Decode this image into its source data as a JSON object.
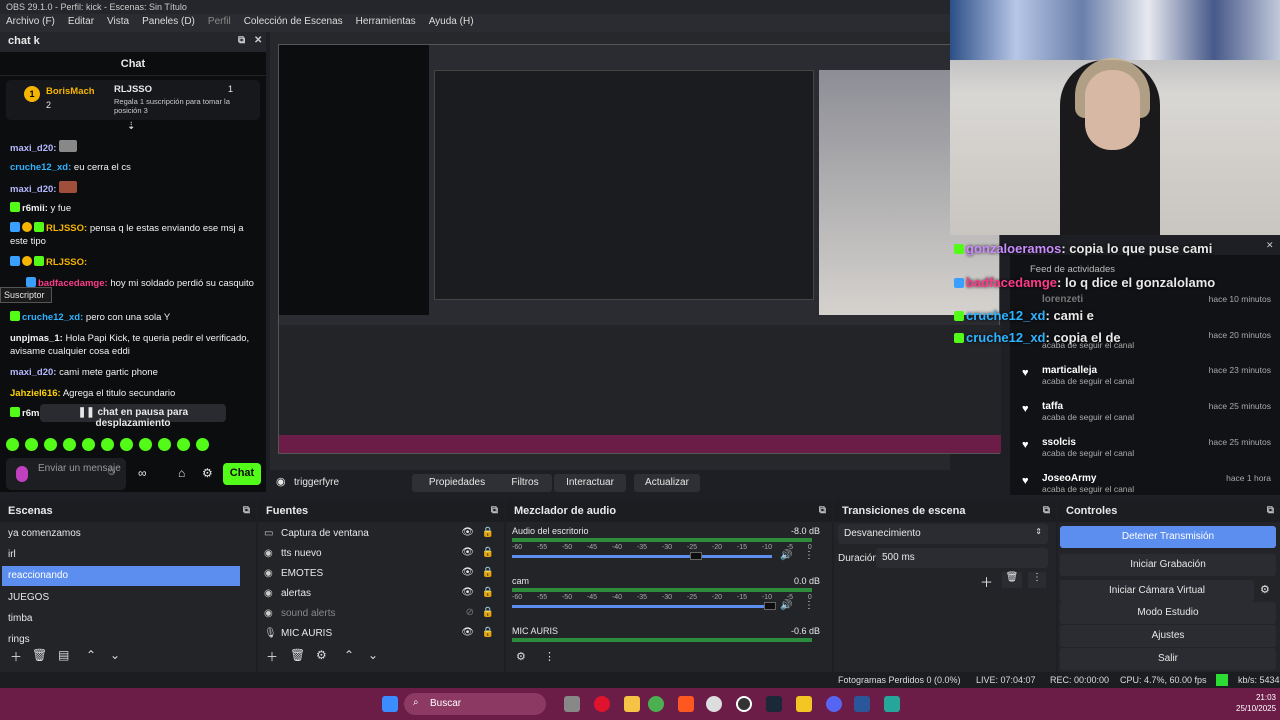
{
  "titlebar": "OBS 29.1.0 - Perfil: kick - Escenas: Sin Título",
  "menu": [
    "Archivo (F)",
    "Editar",
    "Vista",
    "Paneles (D)",
    "Perfil",
    "Colección de Escenas",
    "Herramientas",
    "Ayuda (H)"
  ],
  "chat": {
    "dock_title": "chat k",
    "header": "Chat",
    "pinned": {
      "user1": "BorisMach",
      "count1": "2",
      "user2": "RLJSSO",
      "count2": "1",
      "text": "Regala 1 suscripción para tomar la posición 3"
    },
    "messages": [
      {
        "user": "maxi_d20:",
        "text": "",
        "color": "#b7b7ff"
      },
      {
        "user": "cruche12_xd:",
        "text": "eu cerra el cs",
        "color": "#2fb3ff"
      },
      {
        "user": "maxi_d20:",
        "text": "",
        "color": "#b7b7ff"
      },
      {
        "user": "r6mii:",
        "text": "y fue",
        "color": "#f0f0f0"
      },
      {
        "user": "RLJSSO:",
        "text": "pensa q le estas enviando ese msj a este tipo",
        "color": "#f5b400"
      },
      {
        "user": "RLJSSO:",
        "text": "",
        "color": "#f5b400"
      },
      {
        "user": "badfacedamge:",
        "text": "hoy mi soldado perdió su casquito",
        "color": "#ff3b8a"
      },
      {
        "user": "cruche12_xd:",
        "text": "pero con una sola Y",
        "color": "#2fb3ff"
      },
      {
        "user": "unpjmas_1:",
        "text": "Hola Papi Kick, te queria pedir el verificado, avisame cualquier cosa eddi",
        "color": "#ffffff"
      },
      {
        "user": "maxi_d20:",
        "text": "cami mete gartic phone",
        "color": "#b7b7ff"
      },
      {
        "user": "Jahziel616:",
        "text": "Agrega el titulo secundario",
        "color": "#ffd400"
      },
      {
        "user": "r6m",
        "text": "",
        "color": "#f0f0f0"
      }
    ],
    "tooltip": "Suscriptor",
    "pause": "chat en pausa para desplazamiento",
    "input_placeholder": "Enviar un mensaje",
    "send": "Chat"
  },
  "preview": {
    "source_name": "triggerfyre",
    "buttons": [
      "Propiedades",
      "Filtros",
      "Interactuar",
      "Actualizar"
    ]
  },
  "overlay": {
    "lines": [
      {
        "user": "gonzaloeramos",
        "text": ": copia lo que puse cami",
        "color": "#c98cff"
      },
      {
        "user": "badfacedamge",
        "text": ": lo q dice el gonzalolamo",
        "color": "#ff3b8a"
      },
      {
        "user": "cruche12_xd",
        "text": ": cami e",
        "color": "#2fb3ff"
      },
      {
        "user": "cruche12_xd",
        "text": ": copia el de",
        "color": "#2fb3ff"
      }
    ],
    "feed_title": "Feed de actividades",
    "feed": [
      {
        "name": "lorenzeti",
        "sub": "",
        "time": "hace 10 minutos"
      },
      {
        "name": "",
        "sub": "acaba de seguir el canal",
        "time": "hace 20 minutos"
      },
      {
        "name": "marticalleja",
        "sub": "acaba de seguir el canal",
        "time": "hace 23 minutos"
      },
      {
        "name": "taffa",
        "sub": "acaba de seguir el canal",
        "time": "hace 25 minutos"
      },
      {
        "name": "ssolcis",
        "sub": "acaba de seguir el canal",
        "time": "hace 25 minutos"
      },
      {
        "name": "JoseoArmy",
        "sub": "acaba de seguir el canal",
        "time": "hace 1 hora"
      }
    ]
  },
  "scenes": {
    "title": "Escenas",
    "items": [
      "ya comenzamos",
      "irl",
      "reaccionando",
      "JUEGOS",
      "timba",
      "rings"
    ],
    "selected": 2
  },
  "sources": {
    "title": "Fuentes",
    "items": [
      {
        "name": "Captura de ventana",
        "icon": "▭"
      },
      {
        "name": "tts nuevo",
        "icon": "◉"
      },
      {
        "name": "EMOTES",
        "icon": "◉"
      },
      {
        "name": "alertas",
        "icon": "◉"
      },
      {
        "name": "sound alerts",
        "icon": "◉"
      },
      {
        "name": "MIC AURIS",
        "icon": "🎙"
      }
    ]
  },
  "mixer": {
    "title": "Mezclador de audio",
    "channels": [
      {
        "name": "Audio del escritorio",
        "db": "-8.0 dB"
      },
      {
        "name": "cam",
        "db": "0.0 dB"
      },
      {
        "name": "MIC AURIS",
        "db": "-0.6 dB"
      }
    ],
    "scale": [
      "-60",
      "-55",
      "-50",
      "-45",
      "-40",
      "-35",
      "-30",
      "-25",
      "-20",
      "-15",
      "-10",
      "-5",
      "0"
    ]
  },
  "transitions": {
    "title": "Transiciones de escena",
    "type": "Desvanecimiento",
    "duration_label": "Duración",
    "duration": "500 ms"
  },
  "controls": {
    "title": "Controles",
    "buttons": [
      "Detener Transmisión",
      "Iniciar Grabación",
      "Iniciar Cámara Virtual",
      "Modo Estudio",
      "Ajustes",
      "Salir"
    ]
  },
  "status": {
    "dropped": "Fotogramas Perdidos 0 (0.0%)",
    "live": "LIVE: 07:04:07",
    "rec": "REC: 00:00:00",
    "cpu": "CPU: 4.7%, 60.00 fps",
    "kbs": "kb/s: 5434"
  },
  "taskbar": {
    "search": "Buscar",
    "time": "21:03",
    "date": "25/10/2025"
  }
}
